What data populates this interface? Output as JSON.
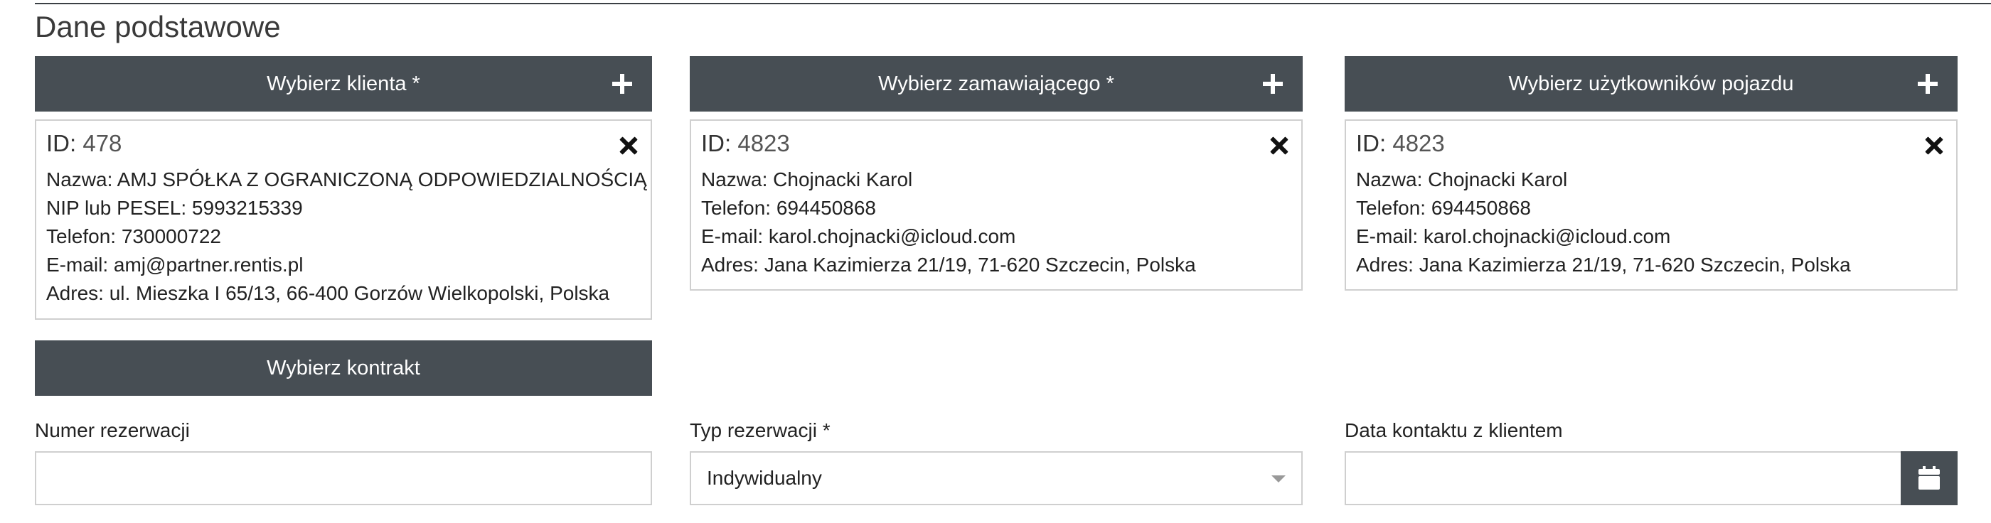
{
  "section_title": "Dane podstawowe",
  "client": {
    "button_label": "Wybierz klienta *",
    "id_label": "ID:",
    "id_value": "478",
    "lines": [
      "Nazwa: AMJ SPÓŁKA Z OGRANICZONĄ ODPOWIEDZIALNOŚCIĄ",
      "NIP lub PESEL: 5993215339",
      "Telefon: 730000722",
      "E-mail: amj@partner.rentis.pl",
      "Adres: ul. Mieszka I 65/13, 66-400 Gorzów Wielkopolski, Polska"
    ]
  },
  "orderer": {
    "button_label": "Wybierz zamawiającego *",
    "id_label": "ID:",
    "id_value": "4823",
    "lines": [
      "Nazwa: Chojnacki Karol",
      "Telefon: 694450868",
      "E-mail: karol.chojnacki@icloud.com",
      "Adres: Jana Kazimierza 21/19, 71-620 Szczecin, Polska"
    ]
  },
  "vehicle_users": {
    "button_label": "Wybierz użytkowników pojazdu",
    "id_label": "ID:",
    "id_value": "4823",
    "lines": [
      "Nazwa: Chojnacki Karol",
      "Telefon: 694450868",
      "E-mail: karol.chojnacki@icloud.com",
      "Adres: Jana Kazimierza 21/19, 71-620 Szczecin, Polska"
    ]
  },
  "contract": {
    "button_label": "Wybierz kontrakt"
  },
  "reservation_number": {
    "label": "Numer rezerwacji",
    "value": "",
    "placeholder": ""
  },
  "reservation_type": {
    "label": "Typ rezerwacji *",
    "selected": "Indywidualny"
  },
  "contact_date": {
    "label": "Data kontaktu z klientem",
    "value": "",
    "placeholder": ""
  },
  "icons": {
    "add": "plus-icon",
    "remove": "close-icon",
    "calendar": "calendar-icon"
  },
  "colors": {
    "button_bg": "#474e54",
    "border": "#cfcfcf",
    "text": "#222222"
  }
}
